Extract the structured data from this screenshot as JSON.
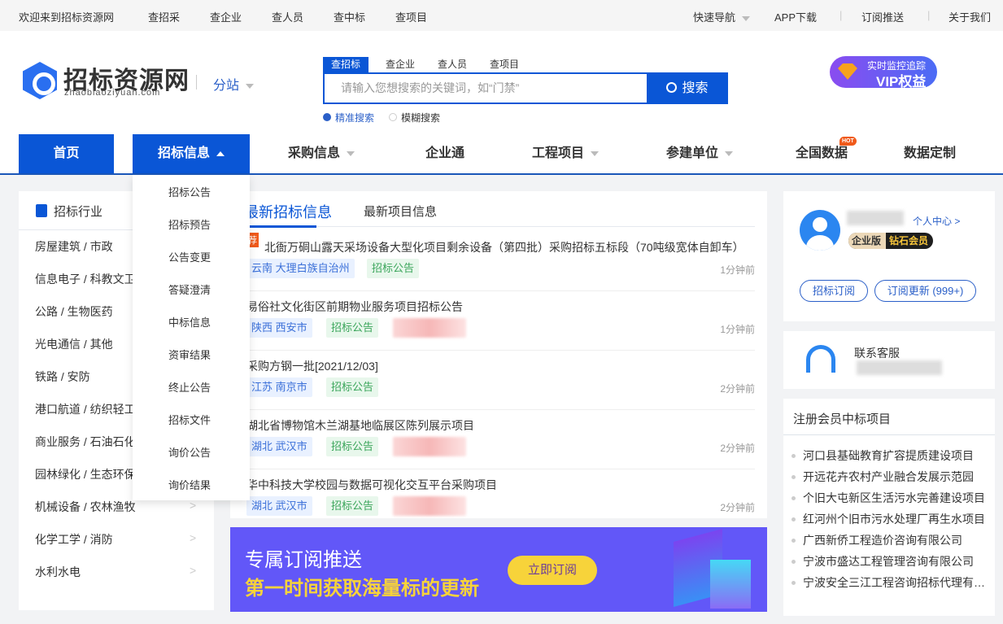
{
  "topbar": {
    "welcome": "欢迎来到招标资源网",
    "links": [
      "查招采",
      "查企业",
      "查人员",
      "查中标",
      "查项目"
    ],
    "quick_nav": "快速导航",
    "app": "APP下载",
    "subscribe": "订阅推送",
    "about": "关于我们"
  },
  "header": {
    "logo_text": "招标资源网",
    "logo_domain": "zhaobiaoziyuan.com",
    "branch": "分站",
    "search_tabs": [
      "查招标",
      "查企业",
      "查人员",
      "查项目"
    ],
    "search_placeholder": "请输入您想搜索的关键词，如“门禁”",
    "search_button": "搜索",
    "modes": [
      "精准搜索",
      "模糊搜索"
    ],
    "vip_line1": "实时监控追踪",
    "vip_line2": "VIP权益"
  },
  "nav": {
    "items": [
      "首页",
      "招标信息",
      "采购信息",
      "企业通",
      "工程项目",
      "参建单位",
      "全国数据",
      "数据定制"
    ],
    "hot_badge": "HOT"
  },
  "dropdown": [
    "招标公告",
    "招标预告",
    "公告变更",
    "答疑澄清",
    "中标信息",
    "资审结果",
    "终止公告",
    "招标文件",
    "询价公告",
    "询价结果"
  ],
  "industry": {
    "title": "招标行业",
    "items": [
      "房屋建筑 / 市政",
      "信息电子 / 科教文卫",
      "公路 / 生物医药",
      "光电通信 / 其他",
      "铁路 / 安防",
      "港口航道 / 纺织轻工",
      "商业服务 / 石油石化",
      "园林绿化 / 生态环保",
      "机械设备 / 农林渔牧",
      "化学工学 / 消防",
      "水利水电"
    ]
  },
  "news": {
    "tabs": [
      "最新招标信息",
      "最新项目信息"
    ],
    "rec_badge": "荐",
    "rows": [
      {
        "title": "北衙万硐山露天采场设备大型化项目剩余设备（第四批）采购招标五标段（70吨级宽体自卸车）",
        "location": "云南 大理白族自治州",
        "type": "招标公告",
        "time": "1分钟前"
      },
      {
        "title": "易俗社文化街区前期物业服务项目招标公告",
        "location": "陕西 西安市",
        "type": "招标公告",
        "time": "1分钟前"
      },
      {
        "title": "采购方钢一批[2021/12/03]",
        "location": "江苏 南京市",
        "type": "招标公告",
        "time": "2分钟前"
      },
      {
        "title": "湖北省博物馆木兰湖基地临展区陈列展示项目",
        "location": "湖北 武汉市",
        "type": "招标公告",
        "time": "2分钟前"
      },
      {
        "title": "华中科技大学校园与数据可视化交互平台采购项目",
        "location": "湖北 武汉市",
        "type": "招标公告",
        "time": "2分钟前"
      }
    ]
  },
  "banner": {
    "line1": "专属订阅推送",
    "line2": "第一时间获取海量标的更新",
    "button": "立即订阅"
  },
  "user": {
    "center_link": "个人中心 >",
    "edition": "企业版",
    "level": "钻石会员",
    "btn_subscribe": "招标订阅",
    "btn_updates": "订阅更新 (999+)"
  },
  "service": {
    "title": "联系客服"
  },
  "winners": {
    "title": "注册会员中标项目",
    "items": [
      "河口县基础教育扩容提质建设项目",
      "开远花卉农村产业融合发展示范园",
      "个旧大屯新区生活污水完善建设项目",
      "红河州个旧市污水处理厂再生水项目",
      "广西新侨工程造价咨询有限公司",
      "宁波市盛达工程管理咨询有限公司",
      "宁波安全三江工程咨询招标代理有限公司"
    ]
  },
  "colors": {
    "primary": "#0a56d6",
    "banner": "#6257f8",
    "button_yellow": "#f7d33a"
  }
}
